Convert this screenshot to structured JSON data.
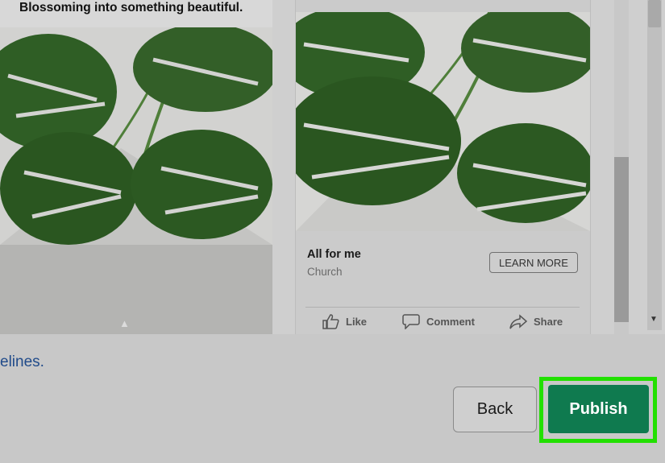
{
  "left_preview": {
    "caption": "Blossoming into something beautiful."
  },
  "card": {
    "title": "All for me",
    "subtitle": "Church",
    "cta_label": "LEARN MORE",
    "actions": {
      "like": "Like",
      "comment": "Comment",
      "share": "Share"
    }
  },
  "footer": {
    "guidelines_text": "elines.",
    "back_label": "Back",
    "publish_label": "Publish"
  },
  "colors": {
    "publish_bg": "#0f7a4f",
    "highlight": "#22e000",
    "link": "#214b8a"
  },
  "icons": [
    "chevron-up-icon",
    "thumbs-up-icon",
    "comment-icon",
    "share-icon",
    "scroll-down-arrow-icon"
  ]
}
